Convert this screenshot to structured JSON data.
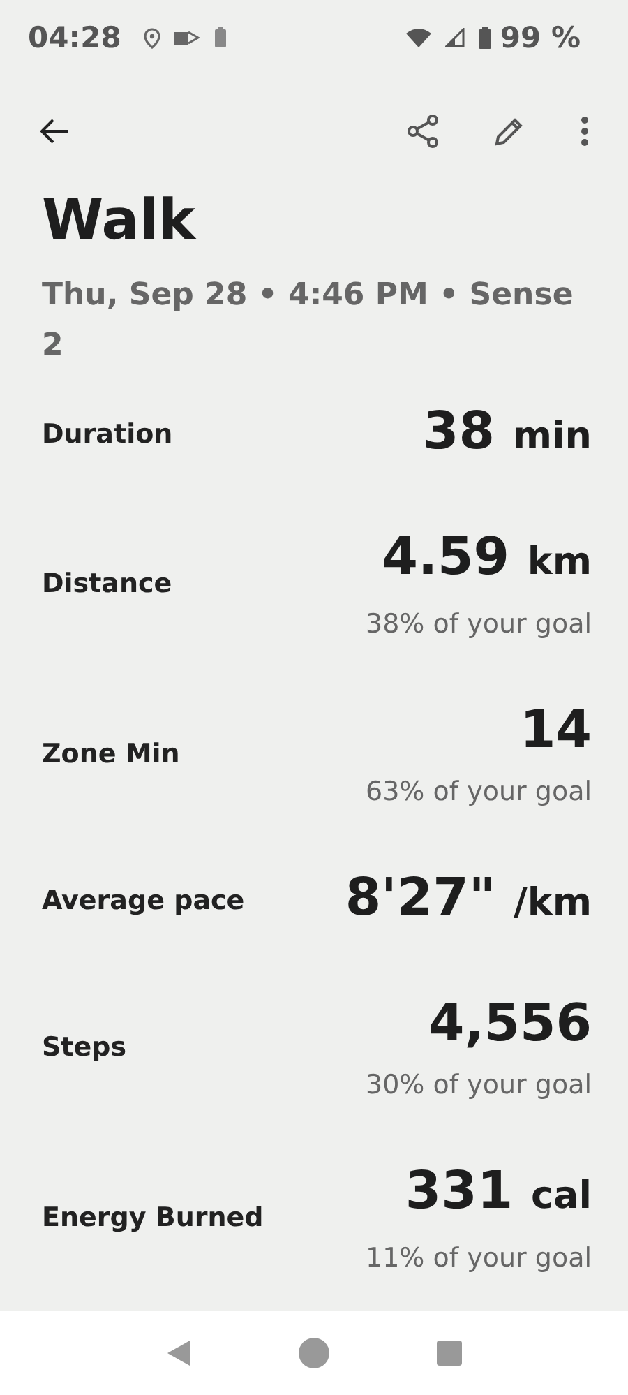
{
  "status_bar": {
    "time": "04:28",
    "battery": "99 %"
  },
  "title": "Walk",
  "subtitle": "Thu, Sep 28 • 4:46 PM • Sense 2",
  "metrics": [
    {
      "label": "Duration",
      "value": "38",
      "unit": "min"
    },
    {
      "label": "Distance",
      "value": "4.59",
      "unit": "km",
      "goal": "38% of your goal"
    },
    {
      "label": "Zone Min",
      "value": "14",
      "goal": "63% of your goal"
    },
    {
      "label": "Average pace",
      "value": "8'27\"",
      "unit": "/km"
    },
    {
      "label": "Steps",
      "value": "4,556",
      "goal": "30% of your goal"
    },
    {
      "label": "Energy Burned",
      "value": "331",
      "unit": "cal",
      "goal": "11% of your goal"
    }
  ]
}
